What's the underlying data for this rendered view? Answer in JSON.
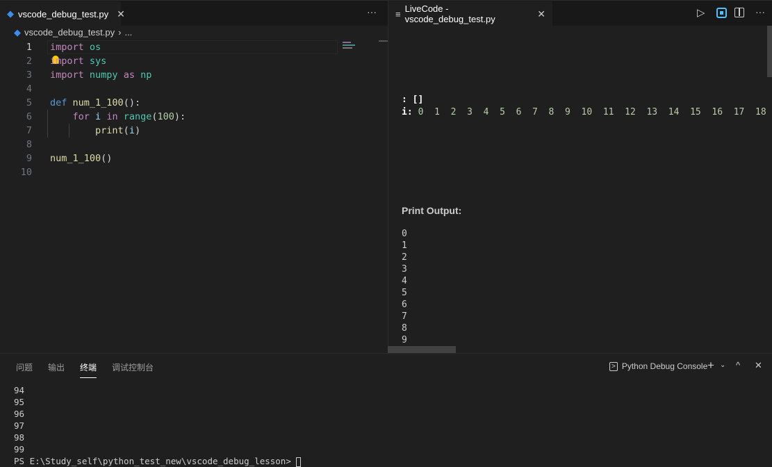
{
  "left_editor": {
    "tab_label": "vscode_debug_test.py",
    "breadcrumb": [
      "vscode_debug_test.py",
      "..."
    ],
    "lines": [
      [
        {
          "t": "import",
          "c": "kw"
        },
        {
          "t": " ",
          "c": "pl"
        },
        {
          "t": "os",
          "c": "mod"
        }
      ],
      [
        {
          "t": "import",
          "c": "kw"
        },
        {
          "t": " ",
          "c": "pl"
        },
        {
          "t": "sys",
          "c": "mod"
        }
      ],
      [
        {
          "t": "import",
          "c": "kw"
        },
        {
          "t": " ",
          "c": "pl"
        },
        {
          "t": "numpy",
          "c": "mod"
        },
        {
          "t": " ",
          "c": "pl"
        },
        {
          "t": "as",
          "c": "kw"
        },
        {
          "t": " ",
          "c": "pl"
        },
        {
          "t": "np",
          "c": "mod"
        }
      ],
      [],
      [
        {
          "t": "def",
          "c": "def"
        },
        {
          "t": " ",
          "c": "pl"
        },
        {
          "t": "num_1_100",
          "c": "fn"
        },
        {
          "t": "():",
          "c": "pl"
        }
      ],
      [
        {
          "t": "    ",
          "c": "pl"
        },
        {
          "t": "for",
          "c": "kw"
        },
        {
          "t": " ",
          "c": "pl"
        },
        {
          "t": "i",
          "c": "var"
        },
        {
          "t": " ",
          "c": "pl"
        },
        {
          "t": "in",
          "c": "kw"
        },
        {
          "t": " ",
          "c": "pl"
        },
        {
          "t": "range",
          "c": "mod"
        },
        {
          "t": "(",
          "c": "pl"
        },
        {
          "t": "100",
          "c": "num"
        },
        {
          "t": "):",
          "c": "pl"
        }
      ],
      [
        {
          "t": "        ",
          "c": "pl"
        },
        {
          "t": "print",
          "c": "fn"
        },
        {
          "t": "(",
          "c": "pl"
        },
        {
          "t": "i",
          "c": "var"
        },
        {
          "t": ")",
          "c": "pl"
        }
      ],
      [],
      [
        {
          "t": "num_1_100",
          "c": "fn"
        },
        {
          "t": "()",
          "c": "pl"
        }
      ],
      []
    ],
    "active_line": 1
  },
  "right_editor": {
    "tab_label": "LiveCode - vscode_debug_test.py",
    "empty_line": ": []",
    "var_label": "i:",
    "var_values": [
      "0",
      "1",
      "2",
      "3",
      "4",
      "5",
      "6",
      "7",
      "8",
      "9",
      "10",
      "11",
      "12",
      "13",
      "14",
      "15",
      "16",
      "17",
      "18"
    ],
    "print_heading": "Print Output:",
    "print_lines": [
      "0",
      "1",
      "2",
      "3",
      "4",
      "5",
      "6",
      "7",
      "8",
      "9"
    ]
  },
  "panel": {
    "tabs": [
      "问题",
      "输出",
      "终端",
      "调试控制台"
    ],
    "active_tab": 2,
    "terminal_name": "Python Debug Console",
    "terminal_lines": [
      "94",
      "95",
      "96",
      "97",
      "98",
      "99"
    ],
    "prompt": "PS E:\\Study_self\\python_test_new\\vscode_debug_lesson> "
  },
  "colors": {
    "accent": "#0078d4",
    "python_icon": "#3b8eea",
    "lightbulb": "#ffcc00"
  }
}
